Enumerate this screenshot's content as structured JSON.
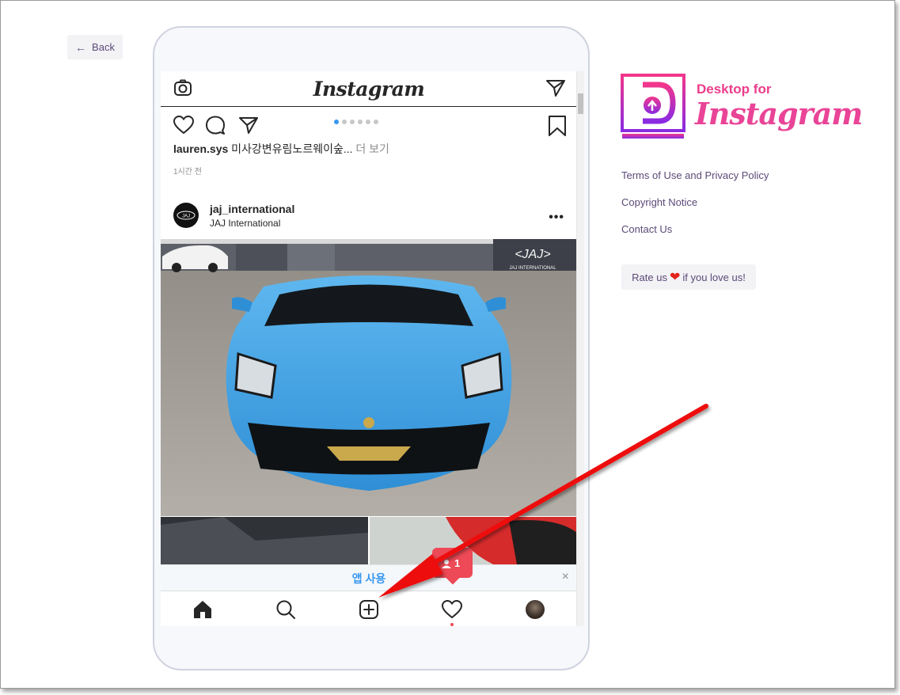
{
  "back": {
    "label": "Back"
  },
  "instagram": {
    "logo": "Instagram",
    "caption": {
      "user": "lauren.sys",
      "text": "미사강변유림노르웨이숲...",
      "more": "더 보기"
    },
    "time": "1시간 전",
    "carousel": {
      "count": 6,
      "active_index": 0
    },
    "post": {
      "username": "jaj_international",
      "location": "JAJ International",
      "watermark": "JAJ INTERNATIONAL"
    },
    "app_banner": {
      "label": "앱 사용",
      "close": "×"
    },
    "notification": {
      "count": "1"
    },
    "nav": [
      "home",
      "search",
      "new-post",
      "activity",
      "profile"
    ]
  },
  "brand": {
    "line1": "Desktop for",
    "line2": "Instagram",
    "colors": {
      "pink": "#e94497",
      "purple": "#7b2ff7"
    }
  },
  "links": [
    "Terms of Use and Privacy Policy",
    "Copyright Notice",
    "Contact Us"
  ],
  "rate": {
    "before": "Rate us",
    "after": "if you love us!"
  },
  "annotation": {
    "arrow_color": "#ee1111"
  }
}
